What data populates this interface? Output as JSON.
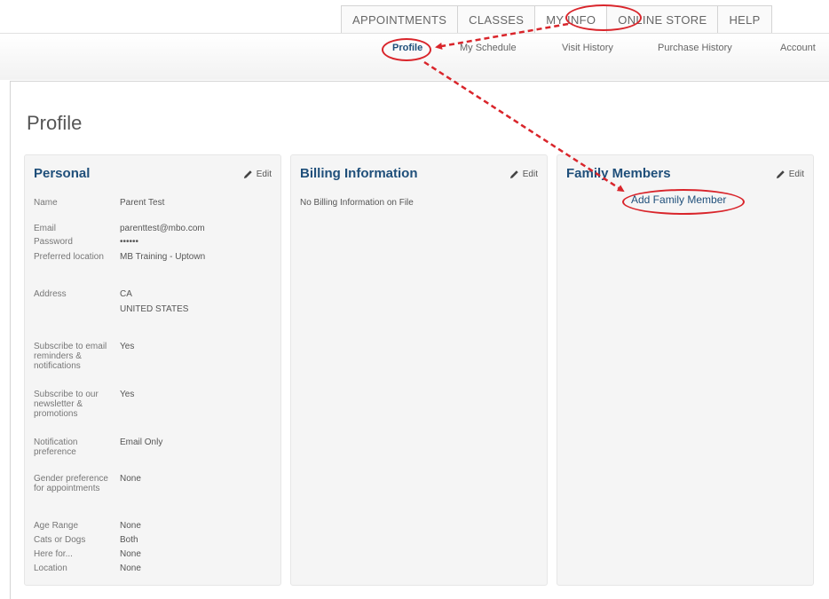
{
  "top_tabs": [
    {
      "label": "APPOINTMENTS",
      "active": false
    },
    {
      "label": "CLASSES",
      "active": false
    },
    {
      "label": "MY INFO",
      "active": true
    },
    {
      "label": "ONLINE STORE",
      "active": false
    },
    {
      "label": "HELP",
      "active": false
    }
  ],
  "sub_nav": [
    {
      "label": "Profile",
      "active": true
    },
    {
      "label": "My Schedule",
      "active": false
    },
    {
      "label": "Visit History",
      "active": false
    },
    {
      "label": "Purchase History",
      "active": false
    },
    {
      "label": "Account",
      "active": false
    }
  ],
  "page": {
    "title": "Profile"
  },
  "personal": {
    "title": "Personal",
    "edit_label": "Edit",
    "fields": [
      {
        "label": "Name",
        "value": [
          "Parent Test"
        ]
      },
      {
        "label": "Email",
        "value": [
          "parenttest@mbo.com"
        ]
      },
      {
        "label": "Password",
        "value": [
          "••••••"
        ]
      },
      {
        "label": "Preferred location",
        "value": [
          "MB Training - Uptown"
        ]
      },
      {
        "label": "Address",
        "value": [
          "CA",
          "UNITED STATES"
        ]
      },
      {
        "label": "Subscribe to email reminders & notifications",
        "value": [
          "Yes"
        ]
      },
      {
        "label": "Subscribe to our newsletter & promotions",
        "value": [
          "Yes"
        ]
      },
      {
        "label": "Notification preference",
        "value": [
          "Email Only"
        ]
      },
      {
        "label": "Gender preference for appointments",
        "value": [
          "None"
        ]
      },
      {
        "label": "Age Range",
        "value": [
          "None"
        ]
      },
      {
        "label": "Cats or Dogs",
        "value": [
          "Both"
        ]
      },
      {
        "label": "Here for...",
        "value": [
          "None"
        ]
      },
      {
        "label": "Location",
        "value": [
          "None"
        ]
      }
    ]
  },
  "billing": {
    "title": "Billing Information",
    "edit_label": "Edit",
    "empty_text": "No Billing Information on File"
  },
  "family": {
    "title": "Family Members",
    "edit_label": "Edit",
    "add_label": "Add Family Member"
  },
  "colors": {
    "link_blue": "#1f4f7a",
    "annotation_red": "#d9252b",
    "panel_bg": "#f5f5f5"
  }
}
